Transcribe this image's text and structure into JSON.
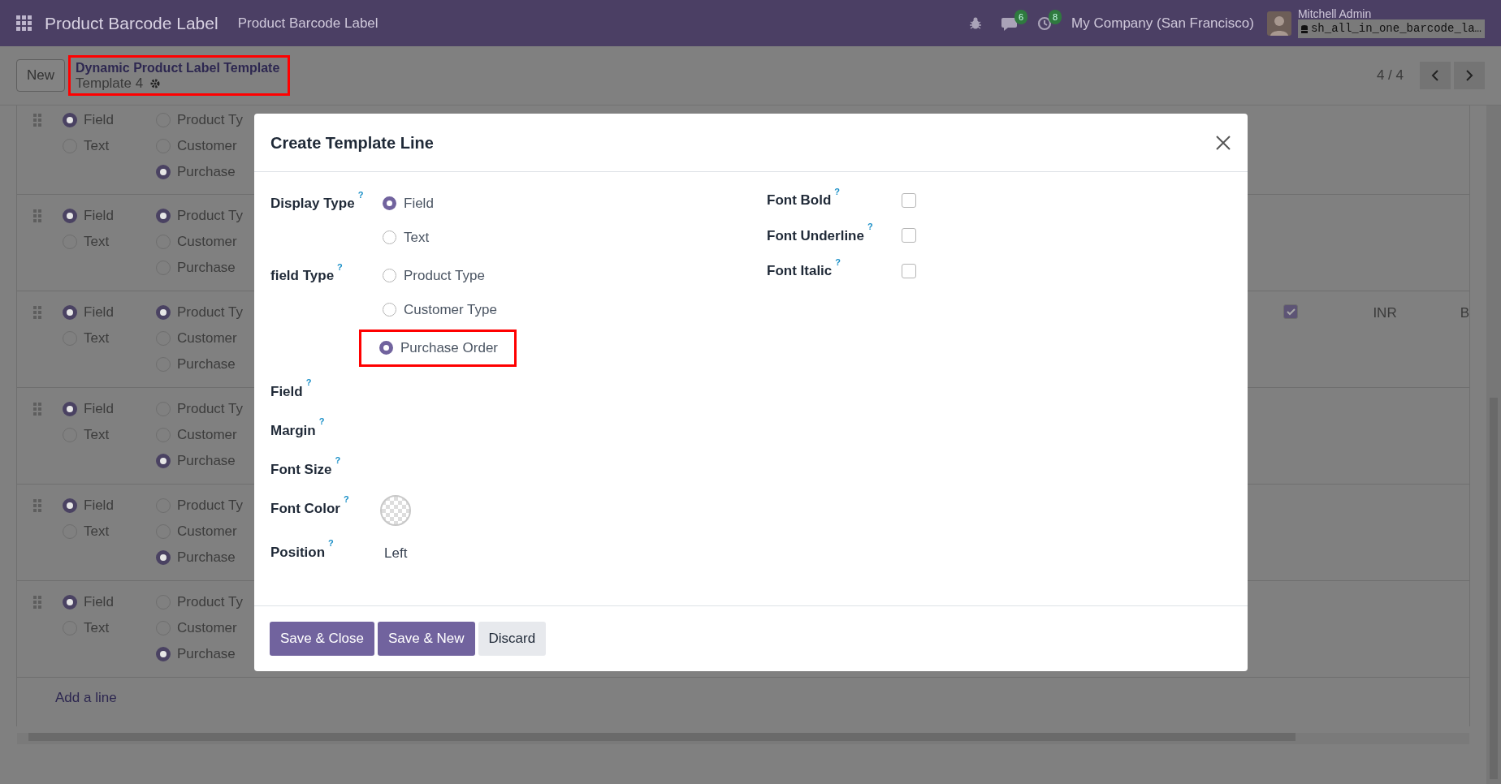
{
  "navbar": {
    "app_name": "Product Barcode Label",
    "menu": "Product Barcode Label",
    "messages_badge": "6",
    "activities_badge": "8",
    "company": "My Company (San Francisco)",
    "user": "Mitchell Admin",
    "database": "sh_all_in_one_barcode_la…"
  },
  "control_panel": {
    "new_button": "New",
    "breadcrumb": "Dynamic Product Label Template",
    "record": "Template 4",
    "highlighted": true,
    "pager": "4 / 4"
  },
  "list_rows": [
    {
      "display_options": [
        {
          "label": "Field",
          "selected": true
        },
        {
          "label": "Text",
          "selected": false
        }
      ],
      "field_type_options": [
        {
          "label": "Product Ty",
          "selected": false
        },
        {
          "label": "Customer",
          "selected": false
        },
        {
          "label": "Purchase",
          "selected": true
        }
      ]
    },
    {
      "display_options": [
        {
          "label": "Field",
          "selected": true
        },
        {
          "label": "Text",
          "selected": false
        }
      ],
      "field_type_options": [
        {
          "label": "Product Ty",
          "selected": true
        },
        {
          "label": "Customer",
          "selected": false
        },
        {
          "label": "Purchase",
          "selected": false
        }
      ]
    },
    {
      "display_options": [
        {
          "label": "Field",
          "selected": true
        },
        {
          "label": "Text",
          "selected": false
        }
      ],
      "field_type_options": [
        {
          "label": "Product Ty",
          "selected": true
        },
        {
          "label": "Customer",
          "selected": false
        },
        {
          "label": "Purchase",
          "selected": false
        }
      ],
      "right_cells": {
        "checked": true,
        "currency": "INR",
        "column_3": "B"
      }
    },
    {
      "display_options": [
        {
          "label": "Field",
          "selected": true
        },
        {
          "label": "Text",
          "selected": false
        }
      ],
      "field_type_options": [
        {
          "label": "Product Ty",
          "selected": false
        },
        {
          "label": "Customer",
          "selected": false
        },
        {
          "label": "Purchase",
          "selected": true
        }
      ]
    },
    {
      "display_options": [
        {
          "label": "Field",
          "selected": true
        },
        {
          "label": "Text",
          "selected": false
        }
      ],
      "field_type_options": [
        {
          "label": "Product Ty",
          "selected": false
        },
        {
          "label": "Customer",
          "selected": false
        },
        {
          "label": "Purchase",
          "selected": true
        }
      ]
    },
    {
      "display_options": [
        {
          "label": "Field",
          "selected": true
        },
        {
          "label": "Text",
          "selected": false
        }
      ],
      "field_type_options": [
        {
          "label": "Product Ty",
          "selected": false
        },
        {
          "label": "Customer",
          "selected": false
        },
        {
          "label": "Purchase",
          "selected": true
        }
      ]
    }
  ],
  "add_line": "Add a line",
  "dialog": {
    "title": "Create Template Line",
    "left_fields": [
      {
        "kind": "radio",
        "label": "Display Type",
        "help": "?",
        "options": [
          {
            "label": "Field",
            "selected": true,
            "highlighted": false
          },
          {
            "label": "Text",
            "selected": false,
            "highlighted": false
          }
        ]
      },
      {
        "kind": "radio",
        "label": "field Type",
        "help": "?",
        "options": [
          {
            "label": "Product Type",
            "selected": false,
            "highlighted": false
          },
          {
            "label": "Customer Type",
            "selected": false,
            "highlighted": false
          },
          {
            "label": "Purchase Order",
            "selected": true,
            "highlighted": true
          }
        ]
      },
      {
        "kind": "empty",
        "label": "Field",
        "help": "?"
      },
      {
        "kind": "empty",
        "label": "Margin",
        "help": "?"
      },
      {
        "kind": "empty",
        "label": "Font Size",
        "help": "?"
      },
      {
        "kind": "color",
        "label": "Font Color",
        "help": "?"
      },
      {
        "kind": "text",
        "label": "Position",
        "help": "?",
        "value": "Left"
      }
    ],
    "right_fields": [
      {
        "label": "Font Bold",
        "help": "?",
        "checked": false
      },
      {
        "label": "Font Underline",
        "help": "?",
        "checked": false
      },
      {
        "label": "Font Italic",
        "help": "?",
        "checked": false
      }
    ],
    "buttons": [
      {
        "label": "Save & Close",
        "kind": "primary"
      },
      {
        "label": "Save & New",
        "kind": "primary"
      },
      {
        "label": "Discard",
        "kind": "secondary"
      }
    ]
  }
}
